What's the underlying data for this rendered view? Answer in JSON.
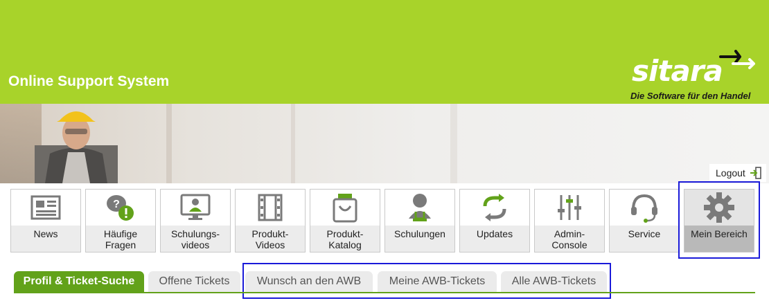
{
  "header": {
    "title": "Online Support System",
    "brand_color": "#a8d32a",
    "logo": {
      "word": "sitara",
      "tagline": "Die Software für den Handel"
    }
  },
  "logout": {
    "label": "Logout",
    "icon": "logout-icon"
  },
  "nav": {
    "items": [
      {
        "label": "News",
        "icon": "newspaper-icon"
      },
      {
        "label": "Häufige\nFragen",
        "icon": "faq-icon"
      },
      {
        "label": "Schulungs-\nvideos",
        "icon": "training-video-icon"
      },
      {
        "label": "Produkt-\nVideos",
        "icon": "film-icon"
      },
      {
        "label": "Produkt-\nKatalog",
        "icon": "shopping-bag-icon"
      },
      {
        "label": "Schulungen",
        "icon": "presenter-icon"
      },
      {
        "label": "Updates",
        "icon": "refresh-icon"
      },
      {
        "label": "Admin-\nConsole",
        "icon": "sliders-icon"
      },
      {
        "label": "Service",
        "icon": "headset-icon"
      },
      {
        "label": "Mein Bereich",
        "icon": "gear-icon",
        "active": true
      }
    ]
  },
  "tabs": {
    "items": [
      {
        "label": "Profil & Ticket-Suche",
        "active": true
      },
      {
        "label": "Offene Tickets"
      },
      {
        "label": "Wunsch an den AWB"
      },
      {
        "label": "Meine AWB-Tickets"
      },
      {
        "label": "Alle AWB-Tickets"
      }
    ],
    "accent_color": "#62a21a"
  },
  "highlight_color": "#1a1ad9"
}
